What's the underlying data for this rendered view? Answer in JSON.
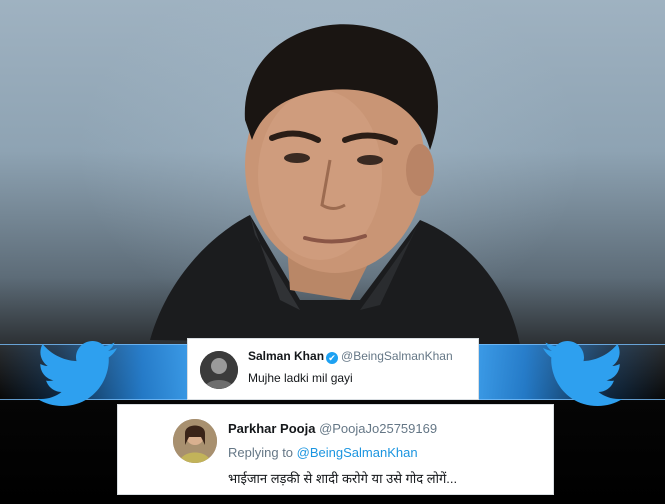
{
  "tweet_main": {
    "display_name": "Salman Khan",
    "handle": "@BeingSalmanKhan",
    "text": "Mujhe ladki mil gayi",
    "verified_icon": "✔"
  },
  "tweet_reply": {
    "display_name": "Parkhar Pooja",
    "handle": "@PoojaJo25759169",
    "replying_prefix": "Replying to",
    "replying_to": "@BeingSalmanKhan",
    "text": "भाईजान लड़की से शादी करोगे या उसे गोद लोगें..."
  },
  "decorations": {
    "icons": [
      "twitter-bird-icon"
    ],
    "accent_color": "#1da1f2"
  }
}
